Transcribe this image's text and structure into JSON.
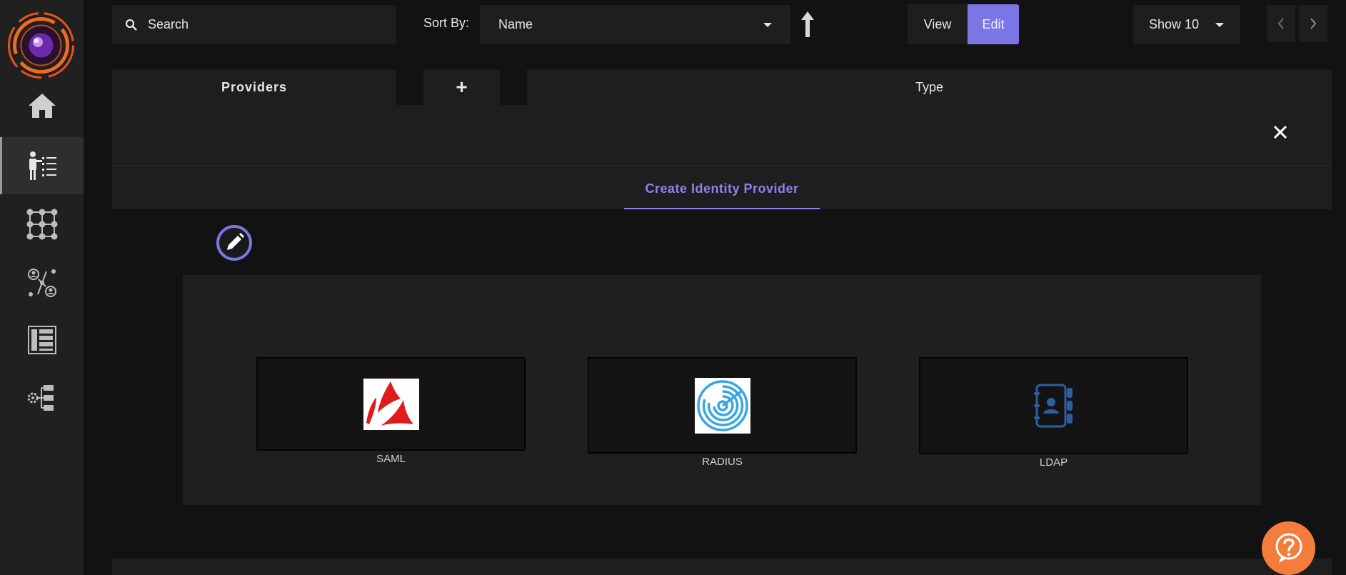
{
  "colors": {
    "accent": "#7b75e6",
    "tab_active": "#8c84f0",
    "help_button": "#f47c3c",
    "saml_red": "#e01b1b",
    "radius_blue": "#3aa6e0",
    "ldap_blue": "#2c5fa0"
  },
  "sidebar": {
    "items": [
      {
        "icon": "home-icon"
      },
      {
        "icon": "user-list-icon",
        "active": true
      },
      {
        "icon": "grid-nodes-icon"
      },
      {
        "icon": "user-network-icon"
      },
      {
        "icon": "layout-list-icon"
      },
      {
        "icon": "settings-tree-icon"
      }
    ]
  },
  "toolbar": {
    "search_placeholder": "Search",
    "sort_label": "Sort By:",
    "sort_value": "Name",
    "view_label": "View",
    "edit_label": "Edit",
    "show_value": "Show 10"
  },
  "table_header": {
    "providers_label": "Providers",
    "add_label": "+",
    "type_label": "Type"
  },
  "dialog": {
    "tab_label": "Create Identity Provider"
  },
  "providers": [
    {
      "label": "SAML",
      "icon": "saml-logo-icon"
    },
    {
      "label": "RADIUS",
      "icon": "radius-logo-icon"
    },
    {
      "label": "LDAP",
      "icon": "ldap-contacts-icon"
    }
  ]
}
